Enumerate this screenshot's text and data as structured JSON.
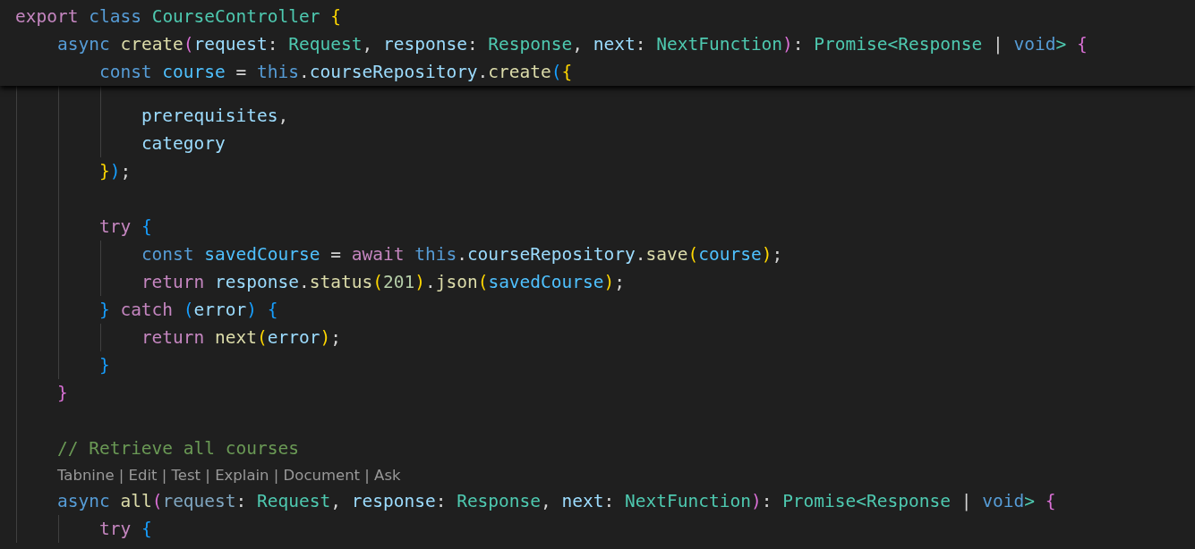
{
  "code": [
    {
      "kind": "code",
      "sticky": true,
      "tokens": [
        {
          "text": "export ",
          "kind": "kw"
        },
        {
          "text": "class ",
          "kind": "st"
        },
        {
          "text": "CourseController ",
          "kind": "ty"
        },
        {
          "text": "{",
          "kind": "b1"
        }
      ],
      "children": [
        {
          "kind": "code",
          "sticky": true,
          "tokens": [
            {
              "text": "async ",
              "kind": "st"
            },
            {
              "text": "create",
              "kind": "fn"
            },
            {
              "text": "(",
              "kind": "b2"
            },
            {
              "text": "request",
              "kind": "var"
            },
            {
              "text": ": ",
              "kind": "p"
            },
            {
              "text": "Request",
              "kind": "ty"
            },
            {
              "text": ", ",
              "kind": "p"
            },
            {
              "text": "response",
              "kind": "var"
            },
            {
              "text": ": ",
              "kind": "p"
            },
            {
              "text": "Response",
              "kind": "ty"
            },
            {
              "text": ", ",
              "kind": "p"
            },
            {
              "text": "next",
              "kind": "var"
            },
            {
              "text": ": ",
              "kind": "p"
            },
            {
              "text": "NextFunction",
              "kind": "ty"
            },
            {
              "text": ")",
              "kind": "b2"
            },
            {
              "text": ": ",
              "kind": "p"
            },
            {
              "text": "Promise",
              "kind": "ty"
            },
            {
              "text": "<",
              "kind": "ty"
            },
            {
              "text": "Response",
              "kind": "ty"
            },
            {
              "text": " | ",
              "kind": "p"
            },
            {
              "text": "void",
              "kind": "st"
            },
            {
              "text": "> ",
              "kind": "ty"
            },
            {
              "text": "{",
              "kind": "b2"
            }
          ],
          "children": [
            {
              "kind": "code",
              "sticky": true,
              "tokens": [
                {
                  "text": "const ",
                  "kind": "st"
                },
                {
                  "text": "course",
                  "kind": "cv"
                },
                {
                  "text": " = ",
                  "kind": "p"
                },
                {
                  "text": "this",
                  "kind": "st"
                },
                {
                  "text": ".",
                  "kind": "p"
                },
                {
                  "text": "courseRepository",
                  "kind": "var"
                },
                {
                  "text": ".",
                  "kind": "p"
                },
                {
                  "text": "create",
                  "kind": "fn"
                },
                {
                  "text": "(",
                  "kind": "b3"
                },
                {
                  "text": "{",
                  "kind": "b1"
                }
              ],
              "children": [
                {
                  "kind": "blank",
                  "sticky": false
                },
                {
                  "kind": "code",
                  "sticky": false,
                  "tokens": [
                    {
                      "text": "prerequisites",
                      "kind": "var"
                    },
                    {
                      "text": ",",
                      "kind": "p"
                    }
                  ]
                },
                {
                  "kind": "code",
                  "sticky": false,
                  "tokens": [
                    {
                      "text": "category",
                      "kind": "var"
                    }
                  ]
                }
              ]
            },
            {
              "kind": "code",
              "sticky": false,
              "tokens": [
                {
                  "text": "}",
                  "kind": "b1"
                },
                {
                  "text": ")",
                  "kind": "b3"
                },
                {
                  "text": ";",
                  "kind": "p"
                }
              ]
            },
            {
              "kind": "blank",
              "sticky": false
            },
            {
              "kind": "code",
              "sticky": false,
              "tokens": [
                {
                  "text": "try ",
                  "kind": "kw"
                },
                {
                  "text": "{",
                  "kind": "b3"
                }
              ],
              "children": [
                {
                  "kind": "code",
                  "sticky": false,
                  "tokens": [
                    {
                      "text": "const ",
                      "kind": "st"
                    },
                    {
                      "text": "savedCourse",
                      "kind": "cv"
                    },
                    {
                      "text": " = ",
                      "kind": "p"
                    },
                    {
                      "text": "await ",
                      "kind": "kw"
                    },
                    {
                      "text": "this",
                      "kind": "st"
                    },
                    {
                      "text": ".",
                      "kind": "p"
                    },
                    {
                      "text": "courseRepository",
                      "kind": "var"
                    },
                    {
                      "text": ".",
                      "kind": "p"
                    },
                    {
                      "text": "save",
                      "kind": "fn"
                    },
                    {
                      "text": "(",
                      "kind": "b1"
                    },
                    {
                      "text": "course",
                      "kind": "cv"
                    },
                    {
                      "text": ")",
                      "kind": "b1"
                    },
                    {
                      "text": ";",
                      "kind": "p"
                    }
                  ]
                },
                {
                  "kind": "code",
                  "sticky": false,
                  "tokens": [
                    {
                      "text": "return ",
                      "kind": "kw"
                    },
                    {
                      "text": "response",
                      "kind": "var"
                    },
                    {
                      "text": ".",
                      "kind": "p"
                    },
                    {
                      "text": "status",
                      "kind": "fn"
                    },
                    {
                      "text": "(",
                      "kind": "b1"
                    },
                    {
                      "text": "201",
                      "kind": "num"
                    },
                    {
                      "text": ")",
                      "kind": "b1"
                    },
                    {
                      "text": ".",
                      "kind": "p"
                    },
                    {
                      "text": "json",
                      "kind": "fn"
                    },
                    {
                      "text": "(",
                      "kind": "b1"
                    },
                    {
                      "text": "savedCourse",
                      "kind": "cv"
                    },
                    {
                      "text": ")",
                      "kind": "b1"
                    },
                    {
                      "text": ";",
                      "kind": "p"
                    }
                  ]
                }
              ]
            },
            {
              "kind": "code",
              "sticky": false,
              "tokens": [
                {
                  "text": "} ",
                  "kind": "b3"
                },
                {
                  "text": "catch ",
                  "kind": "kw"
                },
                {
                  "text": "(",
                  "kind": "b3"
                },
                {
                  "text": "error",
                  "kind": "var"
                },
                {
                  "text": ") ",
                  "kind": "b3"
                },
                {
                  "text": "{",
                  "kind": "b3"
                }
              ],
              "children": [
                {
                  "kind": "code",
                  "sticky": false,
                  "tokens": [
                    {
                      "text": "return ",
                      "kind": "kw"
                    },
                    {
                      "text": "next",
                      "kind": "fn"
                    },
                    {
                      "text": "(",
                      "kind": "b1"
                    },
                    {
                      "text": "error",
                      "kind": "var"
                    },
                    {
                      "text": ")",
                      "kind": "b1"
                    },
                    {
                      "text": ";",
                      "kind": "p"
                    }
                  ]
                }
              ]
            },
            {
              "kind": "code",
              "sticky": false,
              "tokens": [
                {
                  "text": "}",
                  "kind": "b3"
                }
              ]
            }
          ]
        },
        {
          "kind": "code",
          "sticky": false,
          "tokens": [
            {
              "text": "}",
              "kind": "b2"
            }
          ]
        },
        {
          "kind": "blank",
          "sticky": false
        },
        {
          "kind": "code",
          "sticky": false,
          "tokens": [
            {
              "text": "// Retrieve all courses",
              "kind": "cm"
            }
          ]
        },
        {
          "kind": "codelens",
          "sticky": false,
          "text": "Tabnine | Edit | Test | Explain | Document | Ask"
        },
        {
          "kind": "code",
          "sticky": false,
          "tokens": [
            {
              "text": "async ",
              "kind": "st"
            },
            {
              "text": "all",
              "kind": "fn"
            },
            {
              "text": "(",
              "kind": "b2"
            },
            {
              "text": "request",
              "kind": "dim"
            },
            {
              "text": ": ",
              "kind": "p"
            },
            {
              "text": "Request",
              "kind": "ty"
            },
            {
              "text": ", ",
              "kind": "p"
            },
            {
              "text": "response",
              "kind": "var"
            },
            {
              "text": ": ",
              "kind": "p"
            },
            {
              "text": "Response",
              "kind": "ty"
            },
            {
              "text": ", ",
              "kind": "p"
            },
            {
              "text": "next",
              "kind": "var"
            },
            {
              "text": ": ",
              "kind": "p"
            },
            {
              "text": "NextFunction",
              "kind": "ty"
            },
            {
              "text": ")",
              "kind": "b2"
            },
            {
              "text": ": ",
              "kind": "p"
            },
            {
              "text": "Promise",
              "kind": "ty"
            },
            {
              "text": "<",
              "kind": "ty"
            },
            {
              "text": "Response",
              "kind": "ty"
            },
            {
              "text": " | ",
              "kind": "p"
            },
            {
              "text": "void",
              "kind": "st"
            },
            {
              "text": "> ",
              "kind": "ty"
            },
            {
              "text": "{",
              "kind": "b2"
            }
          ],
          "children": [
            {
              "kind": "code",
              "sticky": false,
              "tokens": [
                {
                  "text": "try ",
                  "kind": "kw"
                },
                {
                  "text": "{",
                  "kind": "b3"
                }
              ]
            }
          ]
        }
      ]
    }
  ]
}
